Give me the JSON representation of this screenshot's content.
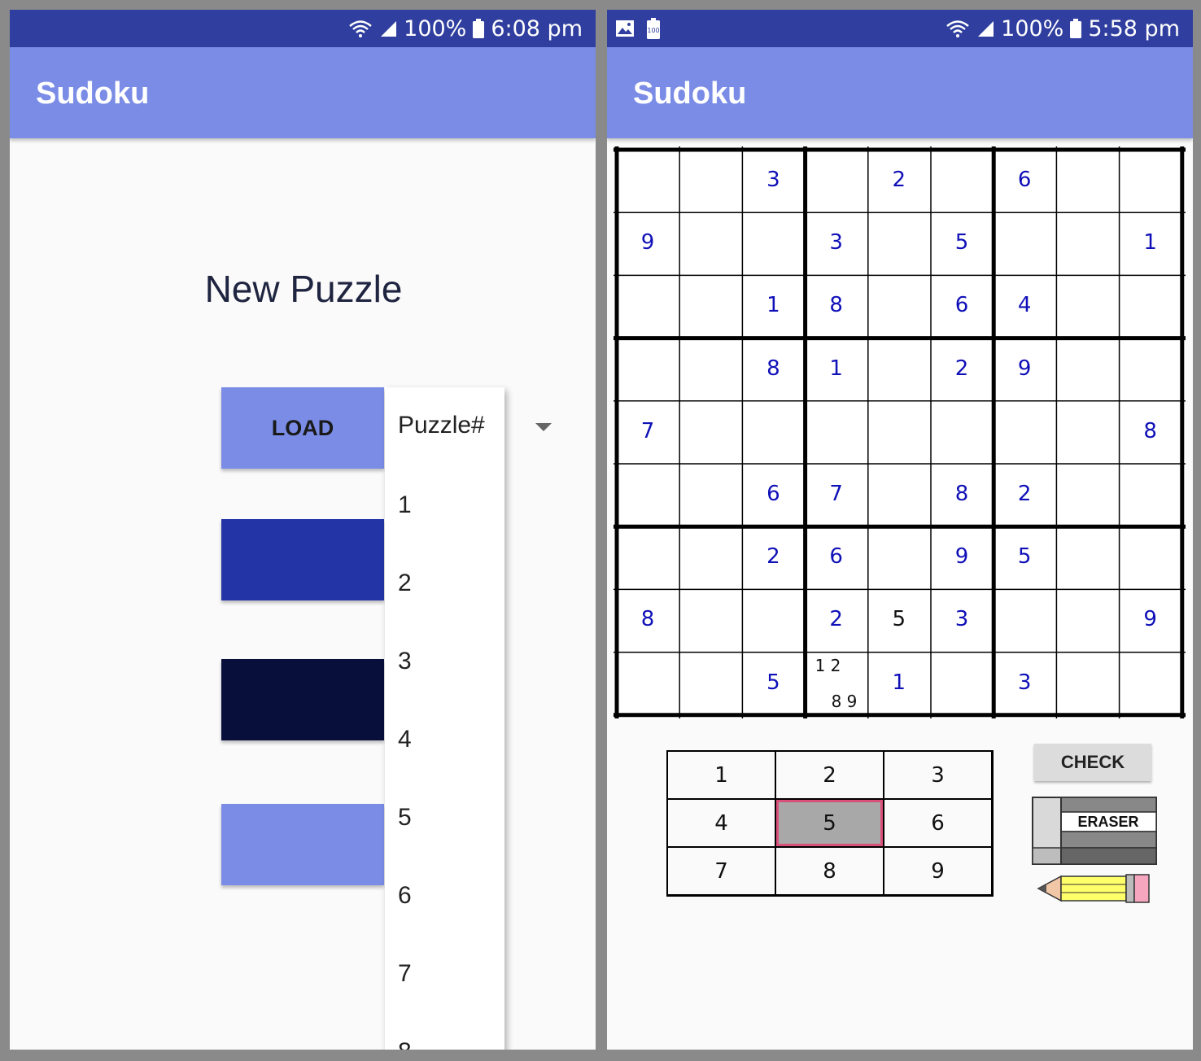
{
  "left_screen": {
    "status_bar": {
      "battery": "100%",
      "time": "6:08 pm"
    },
    "app_title": "Sudoku",
    "heading": "New Puzzle",
    "load_label": "LOAD",
    "dropdown": {
      "header": "Puzzle#",
      "options": [
        "1",
        "2",
        "3",
        "4",
        "5",
        "6",
        "7",
        "8"
      ]
    },
    "colors": {
      "load": "#7a8ce6",
      "button_2": "#2334a6",
      "button_3": "#070f3a",
      "button_4": "#7a8ce6"
    }
  },
  "right_screen": {
    "status_bar": {
      "battery": "100%",
      "time": "5:58 pm",
      "left_icons": [
        "image-icon",
        "battery-100-icon"
      ],
      "battery_icon_text": "100"
    },
    "app_title": "Sudoku",
    "board": [
      [
        "",
        "",
        "3",
        "",
        "2",
        "",
        "6",
        "",
        ""
      ],
      [
        "9",
        "",
        "",
        "3",
        "",
        "5",
        "",
        "",
        "1"
      ],
      [
        "",
        "",
        "1",
        "8",
        "",
        "6",
        "4",
        "",
        ""
      ],
      [
        "",
        "",
        "8",
        "1",
        "",
        "2",
        "9",
        "",
        ""
      ],
      [
        "7",
        "",
        "",
        "",
        "",
        "",
        "",
        "",
        "8"
      ],
      [
        "",
        "",
        "6",
        "7",
        "",
        "8",
        "2",
        "",
        ""
      ],
      [
        "",
        "",
        "2",
        "6",
        "",
        "9",
        "5",
        "",
        ""
      ],
      [
        "8",
        "",
        "",
        "2",
        "5",
        "3",
        "",
        "",
        "9"
      ],
      [
        "",
        "",
        "5",
        "",
        "1",
        "",
        "3",
        "",
        ""
      ]
    ],
    "user_entries": [
      [
        7,
        4
      ]
    ],
    "notes": {
      "row": 8,
      "col": 3,
      "top": "1 2",
      "bottom": "8 9"
    },
    "number_pad": [
      "1",
      "2",
      "3",
      "4",
      "5",
      "6",
      "7",
      "8",
      "9"
    ],
    "selected_number": "5",
    "check_label": "CHECK",
    "eraser_label": "ERASER",
    "colors": {
      "given_digit": "#1010b8",
      "selected_border": "#d9507a"
    }
  }
}
